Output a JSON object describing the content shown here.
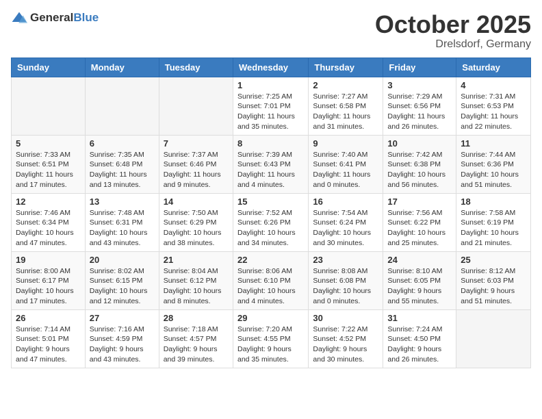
{
  "logo": {
    "general": "General",
    "blue": "Blue"
  },
  "header": {
    "month": "October 2025",
    "location": "Drelsdorf, Germany"
  },
  "weekdays": [
    "Sunday",
    "Monday",
    "Tuesday",
    "Wednesday",
    "Thursday",
    "Friday",
    "Saturday"
  ],
  "weeks": [
    [
      {
        "day": "",
        "info": ""
      },
      {
        "day": "",
        "info": ""
      },
      {
        "day": "",
        "info": ""
      },
      {
        "day": "1",
        "info": "Sunrise: 7:25 AM\nSunset: 7:01 PM\nDaylight: 11 hours\nand 35 minutes."
      },
      {
        "day": "2",
        "info": "Sunrise: 7:27 AM\nSunset: 6:58 PM\nDaylight: 11 hours\nand 31 minutes."
      },
      {
        "day": "3",
        "info": "Sunrise: 7:29 AM\nSunset: 6:56 PM\nDaylight: 11 hours\nand 26 minutes."
      },
      {
        "day": "4",
        "info": "Sunrise: 7:31 AM\nSunset: 6:53 PM\nDaylight: 11 hours\nand 22 minutes."
      }
    ],
    [
      {
        "day": "5",
        "info": "Sunrise: 7:33 AM\nSunset: 6:51 PM\nDaylight: 11 hours\nand 17 minutes."
      },
      {
        "day": "6",
        "info": "Sunrise: 7:35 AM\nSunset: 6:48 PM\nDaylight: 11 hours\nand 13 minutes."
      },
      {
        "day": "7",
        "info": "Sunrise: 7:37 AM\nSunset: 6:46 PM\nDaylight: 11 hours\nand 9 minutes."
      },
      {
        "day": "8",
        "info": "Sunrise: 7:39 AM\nSunset: 6:43 PM\nDaylight: 11 hours\nand 4 minutes."
      },
      {
        "day": "9",
        "info": "Sunrise: 7:40 AM\nSunset: 6:41 PM\nDaylight: 11 hours\nand 0 minutes."
      },
      {
        "day": "10",
        "info": "Sunrise: 7:42 AM\nSunset: 6:38 PM\nDaylight: 10 hours\nand 56 minutes."
      },
      {
        "day": "11",
        "info": "Sunrise: 7:44 AM\nSunset: 6:36 PM\nDaylight: 10 hours\nand 51 minutes."
      }
    ],
    [
      {
        "day": "12",
        "info": "Sunrise: 7:46 AM\nSunset: 6:34 PM\nDaylight: 10 hours\nand 47 minutes."
      },
      {
        "day": "13",
        "info": "Sunrise: 7:48 AM\nSunset: 6:31 PM\nDaylight: 10 hours\nand 43 minutes."
      },
      {
        "day": "14",
        "info": "Sunrise: 7:50 AM\nSunset: 6:29 PM\nDaylight: 10 hours\nand 38 minutes."
      },
      {
        "day": "15",
        "info": "Sunrise: 7:52 AM\nSunset: 6:26 PM\nDaylight: 10 hours\nand 34 minutes."
      },
      {
        "day": "16",
        "info": "Sunrise: 7:54 AM\nSunset: 6:24 PM\nDaylight: 10 hours\nand 30 minutes."
      },
      {
        "day": "17",
        "info": "Sunrise: 7:56 AM\nSunset: 6:22 PM\nDaylight: 10 hours\nand 25 minutes."
      },
      {
        "day": "18",
        "info": "Sunrise: 7:58 AM\nSunset: 6:19 PM\nDaylight: 10 hours\nand 21 minutes."
      }
    ],
    [
      {
        "day": "19",
        "info": "Sunrise: 8:00 AM\nSunset: 6:17 PM\nDaylight: 10 hours\nand 17 minutes."
      },
      {
        "day": "20",
        "info": "Sunrise: 8:02 AM\nSunset: 6:15 PM\nDaylight: 10 hours\nand 12 minutes."
      },
      {
        "day": "21",
        "info": "Sunrise: 8:04 AM\nSunset: 6:12 PM\nDaylight: 10 hours\nand 8 minutes."
      },
      {
        "day": "22",
        "info": "Sunrise: 8:06 AM\nSunset: 6:10 PM\nDaylight: 10 hours\nand 4 minutes."
      },
      {
        "day": "23",
        "info": "Sunrise: 8:08 AM\nSunset: 6:08 PM\nDaylight: 10 hours\nand 0 minutes."
      },
      {
        "day": "24",
        "info": "Sunrise: 8:10 AM\nSunset: 6:05 PM\nDaylight: 9 hours\nand 55 minutes."
      },
      {
        "day": "25",
        "info": "Sunrise: 8:12 AM\nSunset: 6:03 PM\nDaylight: 9 hours\nand 51 minutes."
      }
    ],
    [
      {
        "day": "26",
        "info": "Sunrise: 7:14 AM\nSunset: 5:01 PM\nDaylight: 9 hours\nand 47 minutes."
      },
      {
        "day": "27",
        "info": "Sunrise: 7:16 AM\nSunset: 4:59 PM\nDaylight: 9 hours\nand 43 minutes."
      },
      {
        "day": "28",
        "info": "Sunrise: 7:18 AM\nSunset: 4:57 PM\nDaylight: 9 hours\nand 39 minutes."
      },
      {
        "day": "29",
        "info": "Sunrise: 7:20 AM\nSunset: 4:55 PM\nDaylight: 9 hours\nand 35 minutes."
      },
      {
        "day": "30",
        "info": "Sunrise: 7:22 AM\nSunset: 4:52 PM\nDaylight: 9 hours\nand 30 minutes."
      },
      {
        "day": "31",
        "info": "Sunrise: 7:24 AM\nSunset: 4:50 PM\nDaylight: 9 hours\nand 26 minutes."
      },
      {
        "day": "",
        "info": ""
      }
    ]
  ]
}
